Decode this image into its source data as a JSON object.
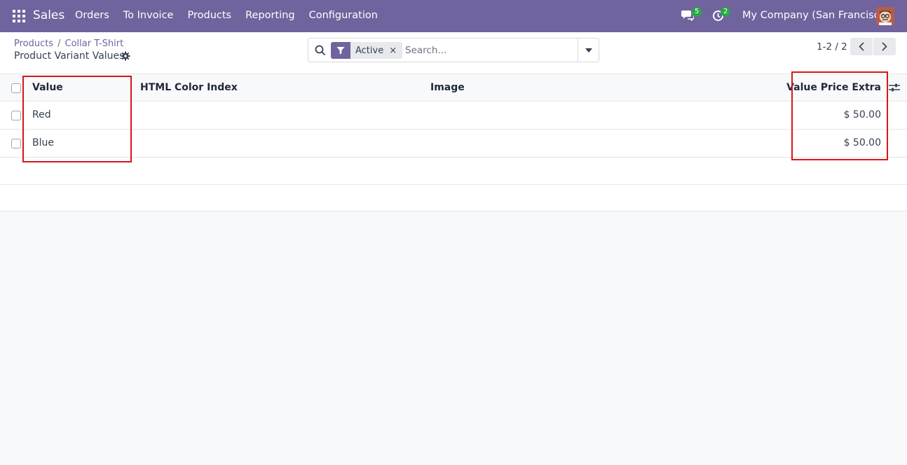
{
  "navbar": {
    "app_name": "Sales",
    "menu": [
      "Orders",
      "To Invoice",
      "Products",
      "Reporting",
      "Configuration"
    ],
    "chat_count": "5",
    "activity_count": "2",
    "company": "My Company (San Francisco)",
    "color": "#71639e"
  },
  "control_panel": {
    "breadcrumb": [
      "Products",
      "Collar T-Shirt"
    ],
    "title": "Product Variant Values",
    "search": {
      "facet": "Active",
      "placeholder": "Search..."
    },
    "pager": "1-2 / 2"
  },
  "table": {
    "headers": {
      "value": "Value",
      "color": "HTML Color Index",
      "image": "Image",
      "price": "Value Price Extra"
    },
    "rows": [
      {
        "value": "Red",
        "color": "",
        "image": "",
        "price": "$ 50.00"
      },
      {
        "value": "Blue",
        "color": "",
        "image": "",
        "price": "$ 50.00"
      }
    ]
  },
  "annotations": {
    "color": "#d9151c"
  }
}
